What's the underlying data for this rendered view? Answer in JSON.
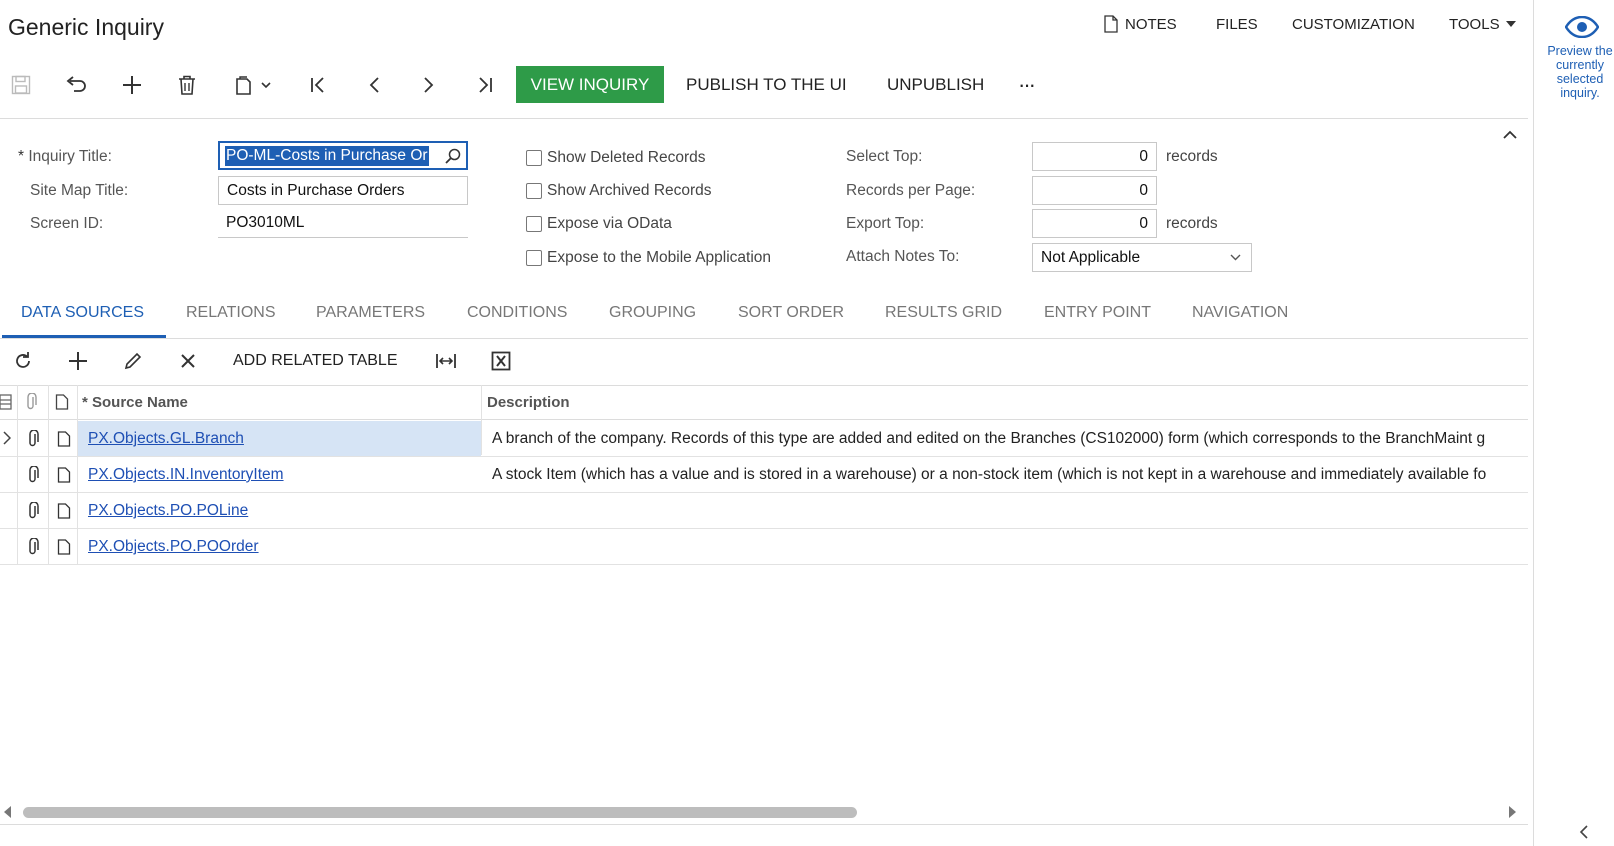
{
  "header": {
    "title": "Generic Inquiry",
    "menu": {
      "notes": "NOTES",
      "files": "FILES",
      "customization": "CUSTOMIZATION",
      "tools": "TOOLS"
    }
  },
  "toolbar": {
    "view_inquiry": "VIEW INQUIRY",
    "publish": "PUBLISH TO THE UI",
    "unpublish": "UNPUBLISH",
    "more": "···"
  },
  "right_panel": {
    "preview_text": "Preview the currently selected inquiry."
  },
  "form": {
    "inquiry_title_label": "Inquiry Title:",
    "inquiry_title_required": "*",
    "inquiry_title_value": "PO-ML-Costs in Purchase Or",
    "site_map_title_label": "Site Map Title:",
    "site_map_title_value": "Costs in Purchase Orders",
    "screen_id_label": "Screen ID:",
    "screen_id_value": "PO3010ML",
    "checkboxes": {
      "show_deleted": "Show Deleted Records",
      "show_archived": "Show Archived Records",
      "expose_odata": "Expose via OData",
      "expose_mobile": "Expose to the Mobile Application"
    },
    "select_top_label": "Select Top:",
    "select_top_value": "0",
    "select_top_unit": "records",
    "records_per_page_label": "Records per Page:",
    "records_per_page_value": "0",
    "export_top_label": "Export Top:",
    "export_top_value": "0",
    "export_top_unit": "records",
    "attach_notes_label": "Attach Notes To:",
    "attach_notes_value": "Not Applicable"
  },
  "tabs": [
    "DATA SOURCES",
    "RELATIONS",
    "PARAMETERS",
    "CONDITIONS",
    "GROUPING",
    "SORT ORDER",
    "RESULTS GRID",
    "ENTRY POINT",
    "NAVIGATION"
  ],
  "grid_toolbar": {
    "add_related_table": "ADD RELATED TABLE"
  },
  "grid": {
    "columns": {
      "source_name": "Source Name",
      "source_name_required": "*",
      "description": "Description"
    },
    "rows": [
      {
        "source_name": "PX.Objects.GL.Branch",
        "description": "A branch of the company. Records of this type are added and edited on the Branches (CS102000) form (which corresponds to the BranchMaint g"
      },
      {
        "source_name": "PX.Objects.IN.InventoryItem",
        "description": "A stock Item (which has a value and is stored in a warehouse) or a non-stock item (which is not kept in a warehouse and immediately available fo"
      },
      {
        "source_name": "PX.Objects.PO.POLine",
        "description": ""
      },
      {
        "source_name": "PX.Objects.PO.POOrder",
        "description": ""
      }
    ]
  },
  "colors": {
    "accent": "#1e5fb4",
    "primary_button": "#2e9b48",
    "selected_row": "#d6e4f5"
  }
}
